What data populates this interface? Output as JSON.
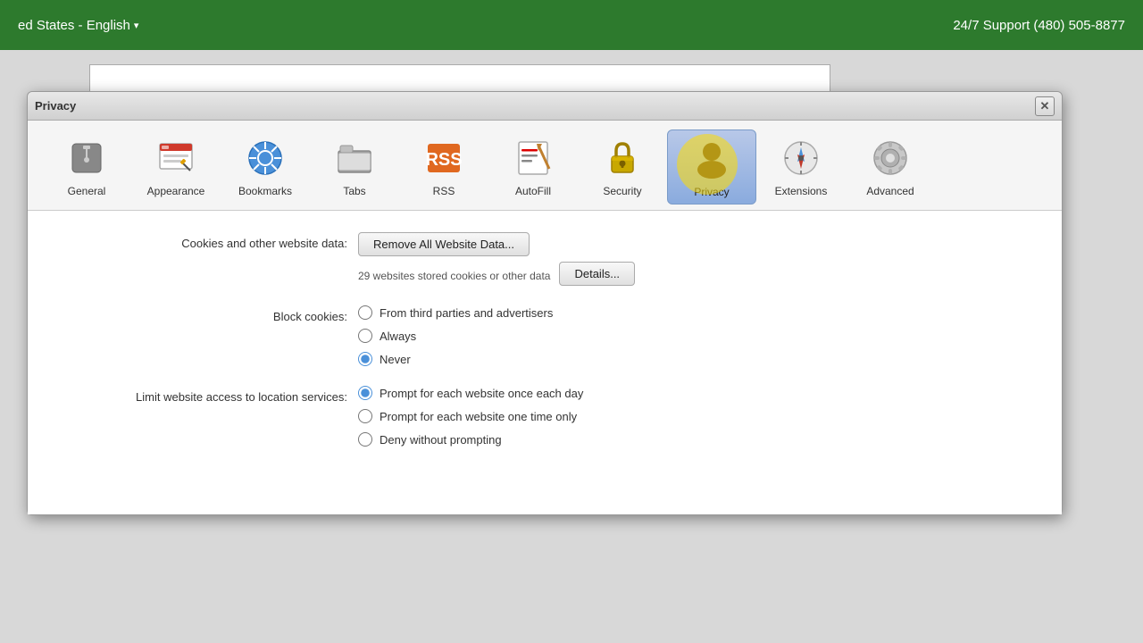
{
  "topBar": {
    "location": "ed States - English",
    "dropdownArrow": "▾",
    "support": "24/7 Support (480) 505-8877"
  },
  "dialog": {
    "title": "Privacy",
    "closeLabel": "✕"
  },
  "toolbar": {
    "items": [
      {
        "id": "general",
        "label": "General",
        "icon": "general"
      },
      {
        "id": "appearance",
        "label": "Appearance",
        "icon": "appearance"
      },
      {
        "id": "bookmarks",
        "label": "Bookmarks",
        "icon": "bookmarks"
      },
      {
        "id": "tabs",
        "label": "Tabs",
        "icon": "tabs"
      },
      {
        "id": "rss",
        "label": "RSS",
        "icon": "rss"
      },
      {
        "id": "autofill",
        "label": "AutoFill",
        "icon": "autofill"
      },
      {
        "id": "security",
        "label": "Security",
        "icon": "security"
      },
      {
        "id": "privacy",
        "label": "Privacy",
        "icon": "privacy",
        "active": true
      },
      {
        "id": "extensions",
        "label": "Extensions",
        "icon": "extensions"
      },
      {
        "id": "advanced",
        "label": "Advanced",
        "icon": "advanced"
      }
    ]
  },
  "content": {
    "cookiesLabel": "Cookies and other website data:",
    "removeAllButton": "Remove All Website Data...",
    "websiteCount": "29 websites stored cookies or other data",
    "detailsButton": "Details...",
    "blockCookiesLabel": "Block cookies:",
    "blockCookiesOptions": [
      {
        "id": "third-parties",
        "label": "From third parties and advertisers",
        "checked": false
      },
      {
        "id": "always",
        "label": "Always",
        "checked": false
      },
      {
        "id": "never",
        "label": "Never",
        "checked": true
      }
    ],
    "locationLabel": "Limit website access to location services:",
    "locationOptions": [
      {
        "id": "prompt-each-day",
        "label": "Prompt for each website once each day",
        "checked": true
      },
      {
        "id": "prompt-one-time",
        "label": "Prompt for each website one time only",
        "checked": false
      },
      {
        "id": "deny",
        "label": "Deny without prompting",
        "checked": false
      }
    ]
  }
}
